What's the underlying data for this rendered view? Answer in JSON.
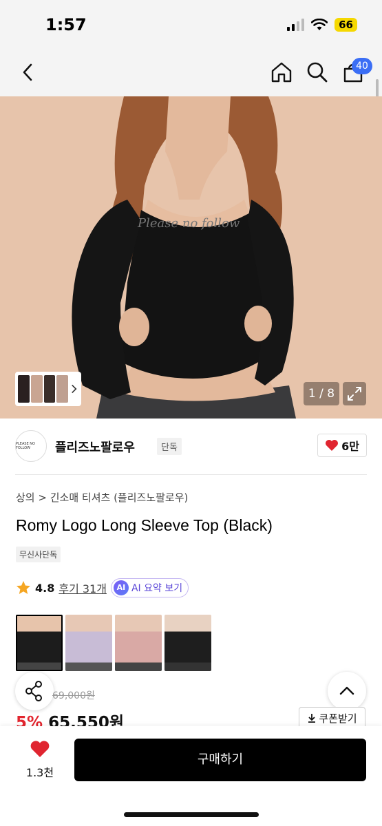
{
  "status_bar": {
    "time": "1:57",
    "battery": "66"
  },
  "nav": {
    "cart_count": "40"
  },
  "hero": {
    "counter": "1 / 8",
    "overlay_text": "Please no follow"
  },
  "brand": {
    "logo_text": "PLEASE NO FOLLOW",
    "name": "플리즈노팔로우",
    "tag": "단독",
    "likes": "6만"
  },
  "product": {
    "category_root": "상의",
    "category_sub": "긴소매 티셔츠 (플리즈노팔로우)",
    "title": "Romy Logo Long Sleeve Top (Black)",
    "exclusive_badge": "무신사단독",
    "rating": "4.8",
    "reviews": "후기 31개",
    "ai_badge": "AI",
    "ai_label": "AI 요약 보기",
    "original_price": "69,000원",
    "discount": "5%",
    "price": "65,550원",
    "coupon_label": "쿠폰받기"
  },
  "bottom_bar": {
    "wish_count": "1.3천",
    "buy_label": "구매하기"
  },
  "colors": {
    "accent": "#3b6ef5",
    "discount": "#e2262f",
    "heart": "#e02530",
    "battery": "#f5d800",
    "ai_purple": "#5b47d8"
  },
  "icons": [
    "back-icon",
    "home-icon",
    "search-icon",
    "cart-icon",
    "expand-icon",
    "heart-icon",
    "star-icon",
    "share-icon",
    "chevron-up-icon",
    "download-icon",
    "chevron-right-icon"
  ]
}
